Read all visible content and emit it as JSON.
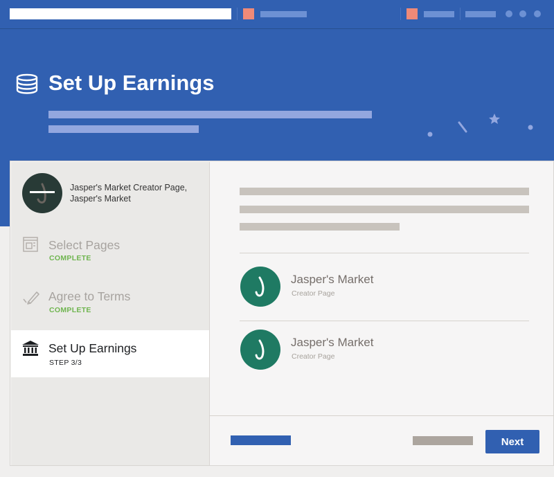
{
  "hero": {
    "title": "Set Up Earnings"
  },
  "sidebar": {
    "page_name": "Jasper's Market Creator Page, Jasper's Market",
    "steps": [
      {
        "title": "Select Pages",
        "status": "COMPLETE",
        "state": "complete",
        "icon": "pages-icon"
      },
      {
        "title": "Agree to Terms",
        "status": "COMPLETE",
        "state": "complete",
        "icon": "pencil-icon"
      },
      {
        "title": "Set Up Earnings",
        "status": "STEP 3/3",
        "state": "active",
        "icon": "bank-icon"
      }
    ]
  },
  "pages": [
    {
      "name": "Jasper's Market",
      "type": "Creator Page"
    },
    {
      "name": "Jasper's Market",
      "type": "Creator Page"
    }
  ],
  "footer": {
    "next_label": "Next"
  },
  "colors": {
    "brand_blue": "#3160b1",
    "complete_green": "#6fb54f",
    "avatar_green": "#1f7a63",
    "avatar_dark": "#283a36",
    "accent_salmon": "#ef8a78"
  }
}
